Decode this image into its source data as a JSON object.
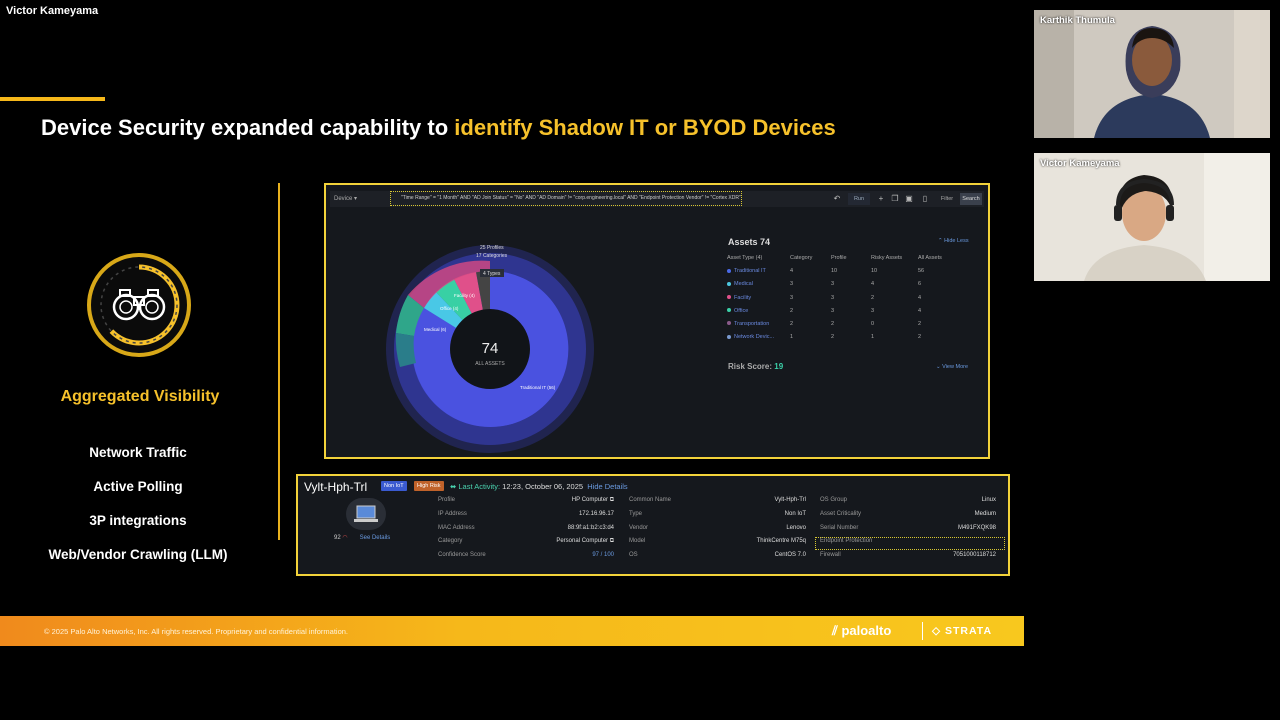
{
  "meeting": {
    "active_speaker": "Victor Kameyama"
  },
  "slide": {
    "title_plain": "Device Security expanded capability to ",
    "title_highlight": "identify Shadow IT or BYOD Devices",
    "visibility_title": "Aggregated Visibility",
    "features": [
      "Network Traffic",
      "Active Polling",
      "3P integrations",
      "Web/Vendor Crawling (LLM)"
    ],
    "footer_copy": "© 2025 Palo Alto Networks, Inc. All rights reserved. Proprietary and confidential information.",
    "footer_logo": "paloalto",
    "footer_product": "STRATA"
  },
  "dashboard": {
    "select": "Device",
    "query": "\"Time Range\" = \"1 Month\"  AND  \"AD Join Status\" = \"No\"  AND  \"AD Domain\" != \"corp.engineering.local\"  AND  \"Endpoint Protection Vendor\" != \"Cortex XDR\"",
    "run_label": "Run",
    "filter_label": "Filter",
    "search_label": "Search",
    "donut_center_value": "74",
    "donut_center_label": "ALL ASSETS",
    "donut_annotations": [
      "25 Profiles",
      "17 Categories",
      "4 Types"
    ],
    "segment_labels": {
      "facility": "Facility (4)",
      "office": "Office (4)",
      "medical": "Medical (6)",
      "traditional": "Traditional IT (56)"
    },
    "assets_title": "Assets 74",
    "view_less": "Hide Less",
    "table_headers": [
      "Asset Type (4)",
      "Category",
      "Profile",
      "Risky Assets",
      "All Assets"
    ],
    "table_rows": [
      {
        "name": "Traditional IT",
        "color": "#4a6ae8",
        "category": "4",
        "profile": "10",
        "risky": "10",
        "all": "56"
      },
      {
        "name": "Medical",
        "color": "#4cc7e0",
        "category": "3",
        "profile": "3",
        "risky": "4",
        "all": "6"
      },
      {
        "name": "Facility",
        "color": "#e0508a",
        "category": "3",
        "profile": "3",
        "risky": "2",
        "all": "4"
      },
      {
        "name": "Office",
        "color": "#3bd0a8",
        "category": "2",
        "profile": "3",
        "risky": "3",
        "all": "4"
      },
      {
        "name": "Transportation",
        "color": "#8a5a8a",
        "category": "2",
        "profile": "2",
        "risky": "0",
        "all": "2"
      },
      {
        "name": "Network Devic...",
        "color": "#7a9ad0",
        "category": "1",
        "profile": "2",
        "risky": "1",
        "all": "2"
      }
    ],
    "risk_label": "Risk Score:",
    "risk_value": "19",
    "view_more": "View More"
  },
  "device": {
    "name": "Vylt-Hph-Trl",
    "badge_noniot": "Non IoT",
    "badge_risk": "High Risk",
    "last_activity_label": "Last Activity:",
    "last_activity_time": "12:23, October 06, 2025",
    "hide_details": "Hide Details",
    "risk_score": "92",
    "see_details": "See Details",
    "col1": [
      {
        "label": "Profile",
        "value": "HP Computer ⧉"
      },
      {
        "label": "IP Address",
        "value": "172.16.96.17"
      },
      {
        "label": "MAC Address",
        "value": "88:9f:a1:b2:c3:d4"
      },
      {
        "label": "Category",
        "value": "Personal Computer ⧉"
      },
      {
        "label": "Confidence Score",
        "value": "97 / 100"
      }
    ],
    "col2": [
      {
        "label": "Common Name",
        "value": "Vylt-Hph-Trl"
      },
      {
        "label": "Type",
        "value": "Non IoT"
      },
      {
        "label": "Vendor",
        "value": "Lenovo"
      },
      {
        "label": "Model",
        "value": "ThinkCentre M75q"
      },
      {
        "label": "OS",
        "value": "CentOS 7.0"
      }
    ],
    "col3": [
      {
        "label": "OS Group",
        "value": "Linux"
      },
      {
        "label": "Asset Criticality",
        "value": "Medium"
      },
      {
        "label": "Serial Number",
        "value": "M491FXQK98"
      },
      {
        "label": "Endpoint Protection",
        "value": ""
      },
      {
        "label": "Firewall",
        "value": "7051000118712"
      }
    ]
  },
  "participants": [
    {
      "name": "Karthik Thumula"
    },
    {
      "name": "Victor Kameyama"
    }
  ],
  "colors": {
    "accent": "#f6c12b",
    "panel_border": "#f2d23a",
    "donut_main": "#4a52e0",
    "teal": "#3bd0a8"
  }
}
